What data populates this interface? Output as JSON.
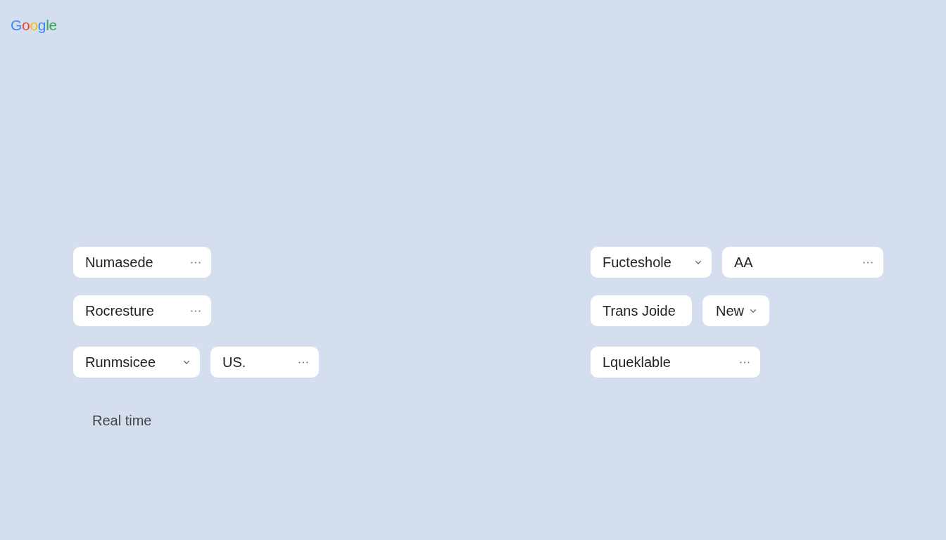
{
  "logo": "Google",
  "left_panel": {
    "rows": [
      [
        {
          "label": "Numasede",
          "kind": "menu"
        }
      ],
      [
        {
          "label": "Rocresture",
          "kind": "menu"
        }
      ],
      [
        {
          "label": "Runmsicee",
          "kind": "dropdown"
        },
        {
          "label": "US.",
          "kind": "menu"
        }
      ]
    ],
    "caption": "Real time"
  },
  "right_panel": {
    "rows": [
      [
        {
          "label": "Fucteshole",
          "kind": "dropdown"
        },
        {
          "label": "AA",
          "kind": "menu"
        }
      ],
      [
        {
          "label": "Trans Joide",
          "kind": "plain"
        },
        {
          "label": "New",
          "kind": "dropdown"
        }
      ],
      [
        {
          "label": "Lqueklable",
          "kind": "menu"
        }
      ]
    ]
  }
}
